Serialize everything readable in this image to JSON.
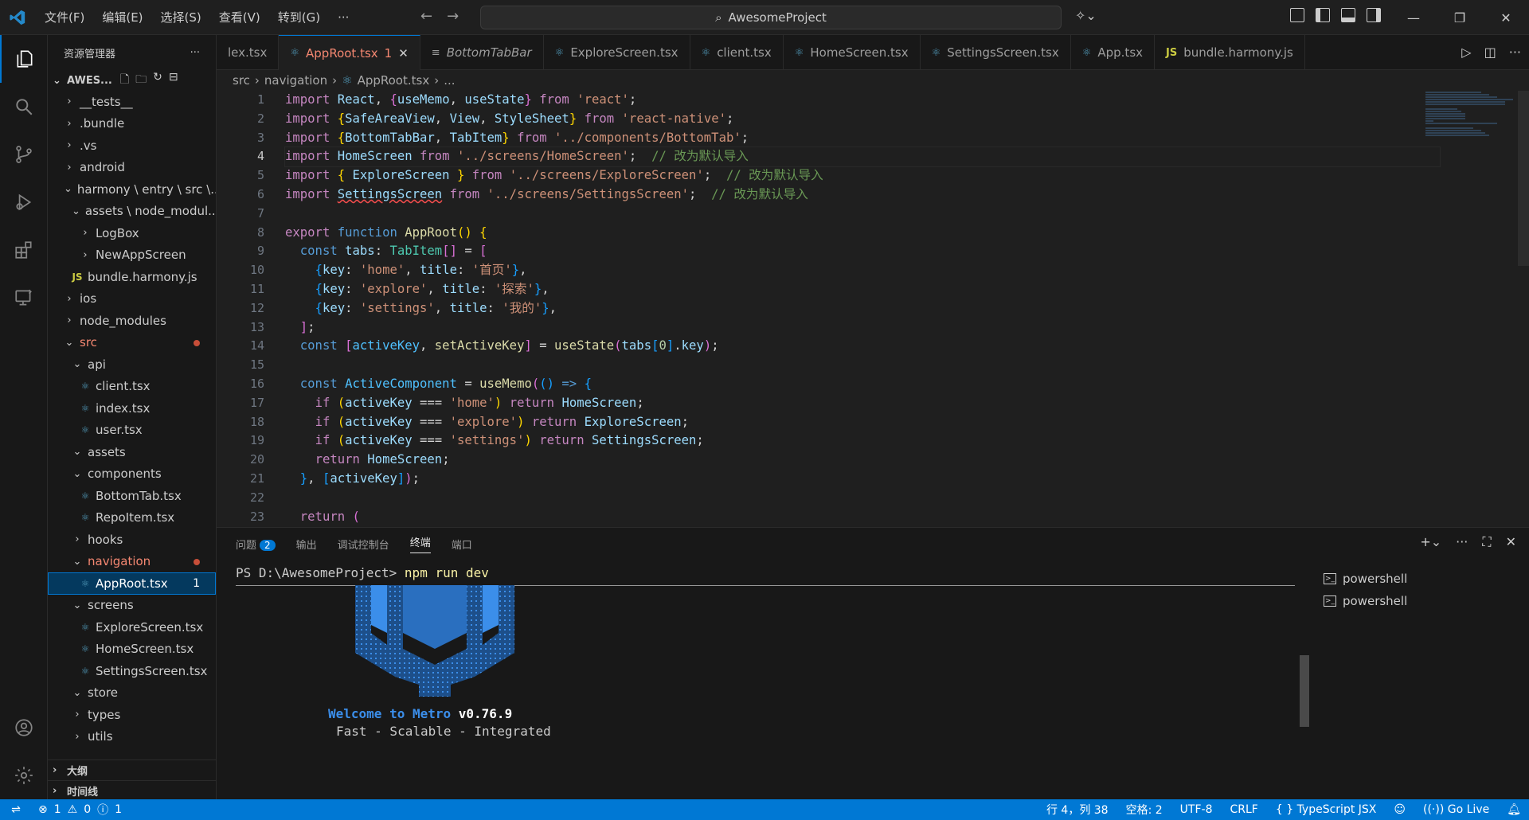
{
  "titlebar": {
    "menu": [
      "文件(F)",
      "编辑(E)",
      "选择(S)",
      "查看(V)",
      "转到(G)",
      "···"
    ],
    "search": "AwesomeProject"
  },
  "sidebar": {
    "title": "资源管理器",
    "project": "AWES...",
    "tree": [
      {
        "label": "__tests__",
        "type": "folder",
        "expanded": false,
        "indent": 0
      },
      {
        "label": ".bundle",
        "type": "folder",
        "expanded": false,
        "indent": 0
      },
      {
        "label": ".vs",
        "type": "folder",
        "expanded": false,
        "indent": 0
      },
      {
        "label": "android",
        "type": "folder",
        "expanded": false,
        "indent": 0
      },
      {
        "label": "harmony \\ entry \\ src \\...",
        "type": "folder",
        "expanded": true,
        "indent": 0
      },
      {
        "label": "assets \\ node_modul...",
        "type": "folder",
        "expanded": true,
        "indent": 1
      },
      {
        "label": "LogBox",
        "type": "folder",
        "expanded": false,
        "indent": 2
      },
      {
        "label": "NewAppScreen",
        "type": "folder",
        "expanded": false,
        "indent": 2
      },
      {
        "label": "bundle.harmony.js",
        "type": "js",
        "indent": 1
      },
      {
        "label": "ios",
        "type": "folder",
        "expanded": false,
        "indent": 0
      },
      {
        "label": "node_modules",
        "type": "folder",
        "expanded": false,
        "indent": 0
      },
      {
        "label": "src",
        "type": "folder",
        "expanded": true,
        "indent": 0,
        "status": "red"
      },
      {
        "label": "api",
        "type": "folder",
        "expanded": true,
        "indent": 1
      },
      {
        "label": "client.tsx",
        "type": "react",
        "indent": 2
      },
      {
        "label": "index.tsx",
        "type": "react",
        "indent": 2
      },
      {
        "label": "user.tsx",
        "type": "react",
        "indent": 2
      },
      {
        "label": "assets",
        "type": "folder",
        "expanded": true,
        "indent": 1
      },
      {
        "label": "components",
        "type": "folder",
        "expanded": true,
        "indent": 1
      },
      {
        "label": "BottomTab.tsx",
        "type": "react",
        "indent": 2
      },
      {
        "label": "RepoItem.tsx",
        "type": "react",
        "indent": 2
      },
      {
        "label": "hooks",
        "type": "folder",
        "expanded": false,
        "indent": 1
      },
      {
        "label": "navigation",
        "type": "folder",
        "expanded": true,
        "indent": 1,
        "status": "red"
      },
      {
        "label": "AppRoot.tsx",
        "type": "react",
        "indent": 2,
        "selected": true,
        "badge": "1"
      },
      {
        "label": "screens",
        "type": "folder",
        "expanded": true,
        "indent": 1
      },
      {
        "label": "ExploreScreen.tsx",
        "type": "react",
        "indent": 2
      },
      {
        "label": "HomeScreen.tsx",
        "type": "react",
        "indent": 2
      },
      {
        "label": "SettingsScreen.tsx",
        "type": "react",
        "indent": 2
      },
      {
        "label": "store",
        "type": "folder",
        "expanded": true,
        "indent": 1
      },
      {
        "label": "types",
        "type": "folder",
        "expanded": false,
        "indent": 1
      },
      {
        "label": "utils",
        "type": "folder",
        "expanded": false,
        "indent": 1
      }
    ],
    "outline": "大纲",
    "timeline": "时间线"
  },
  "tabs": [
    {
      "label": "lex.tsx",
      "icon": "",
      "active": false
    },
    {
      "label": "AppRoot.tsx",
      "icon": "react",
      "active": true,
      "badge": "1"
    },
    {
      "label": "BottomTabBar",
      "icon": "symbol",
      "active": false,
      "italic": true
    },
    {
      "label": "ExploreScreen.tsx",
      "icon": "react",
      "active": false
    },
    {
      "label": "client.tsx",
      "icon": "react",
      "active": false
    },
    {
      "label": "HomeScreen.tsx",
      "icon": "react",
      "active": false
    },
    {
      "label": "SettingsScreen.tsx",
      "icon": "react",
      "active": false
    },
    {
      "label": "App.tsx",
      "icon": "react",
      "active": false
    },
    {
      "label": "bundle.harmony.js",
      "icon": "js",
      "active": false
    }
  ],
  "breadcrumb": [
    "src",
    "navigation",
    "AppRoot.tsx",
    "..."
  ],
  "editor": {
    "line_numbers": [
      "1",
      "2",
      "3",
      "4",
      "5",
      "6",
      "7",
      "8",
      "9",
      "10",
      "11",
      "12",
      "13",
      "14",
      "15",
      "16",
      "17",
      "18",
      "19",
      "20",
      "21",
      "22",
      "23"
    ],
    "current_line": 4
  },
  "panel": {
    "tabs": [
      "问题",
      "输出",
      "调试控制台",
      "终端",
      "端口"
    ],
    "problems_count": "2",
    "active_tab": "终端",
    "prompt": "PS D:\\AwesomeProject> ",
    "command": "npm run dev",
    "welcome_prefix": "Welcome to Metro ",
    "welcome_version": "v0.76.9",
    "tagline": "Fast - Scalable - Integrated",
    "terminals": [
      "powershell",
      "powershell"
    ]
  },
  "statusbar": {
    "errors": "1",
    "warnings": "0",
    "info": "1",
    "position": "行 4，列 38",
    "spaces": "空格: 2",
    "encoding": "UTF-8",
    "eol": "CRLF",
    "language": "TypeScript JSX",
    "golive": "Go Live"
  },
  "colors": {
    "accent": "#0078d4",
    "status_bar": "#0078d4",
    "error_tab": "#f48771"
  }
}
